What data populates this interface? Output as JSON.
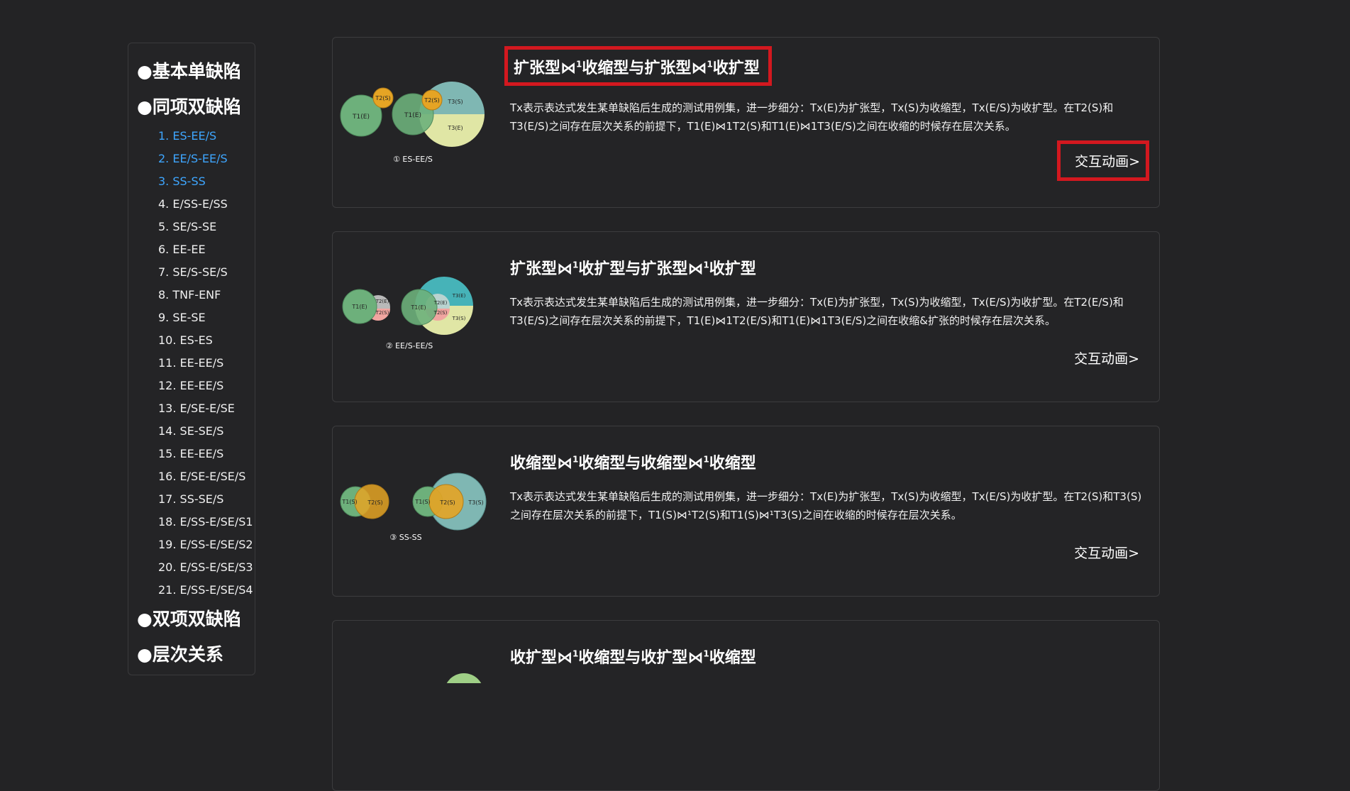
{
  "sidebar": {
    "sections": [
      {
        "label": "●基本单缺陷"
      },
      {
        "label": "●同项双缺陷"
      },
      {
        "label": "●双项双缺陷"
      },
      {
        "label": "●层次关系"
      }
    ],
    "items": [
      {
        "label": "1. ES-EE/S"
      },
      {
        "label": "2. EE/S-EE/S"
      },
      {
        "label": "3. SS-SS"
      },
      {
        "label": "4. E/SS-E/SS"
      },
      {
        "label": "5. SE/S-SE"
      },
      {
        "label": "6. EE-EE"
      },
      {
        "label": "7. SE/S-SE/S"
      },
      {
        "label": "8. TNF-ENF"
      },
      {
        "label": "9. SE-SE"
      },
      {
        "label": "10. ES-ES"
      },
      {
        "label": "11. EE-EE/S"
      },
      {
        "label": "12. EE-EE/S"
      },
      {
        "label": "13. E/SE-E/SE"
      },
      {
        "label": "14. SE-SE/S"
      },
      {
        "label": "15. EE-EE/S"
      },
      {
        "label": "16. E/SE-E/SE/S"
      },
      {
        "label": "17. SS-SE/S"
      },
      {
        "label": "18. E/SS-E/SE/S1"
      },
      {
        "label": "19. E/SS-E/SE/S2"
      },
      {
        "label": "20. E/SS-E/SE/S3"
      },
      {
        "label": "21. E/SS-E/SE/S4"
      }
    ],
    "active_color": "#3ea6ff"
  },
  "cards": [
    {
      "title_a": "扩张型⋈",
      "title_sup1": "1",
      "title_b": "收缩型与扩张型⋈",
      "title_sup2": "1",
      "title_c": "收扩型",
      "desc": "Tx表示表达式发生某单缺陷后生成的测试用例集，进一步细分：Tx(E)为扩张型，Tx(S)为收缩型，Tx(E/S)为收扩型。在T2(S)和T3(E/S)之间存在层次关系的前提下，T1(E)⋈1T2(S)和T1(E)⋈1T3(E/S)之间在收缩的时候存在层次关系。",
      "button": "交互动画>",
      "figure": {
        "c1": "T1(E)",
        "c2": "T2(S)",
        "c3": "T1(E)",
        "c4": "T2(S)",
        "c5": "T3(S)",
        "c6": "T3(E)",
        "caption": "① ES-EE/S"
      }
    },
    {
      "title_a": "扩张型⋈",
      "title_sup1": "1",
      "title_b": "收扩型与扩张型⋈",
      "title_sup2": "1",
      "title_c": "收扩型",
      "desc": "Tx表示表达式发生某单缺陷后生成的测试用例集，进一步细分：Tx(E)为扩张型，Tx(S)为收缩型，Tx(E/S)为收扩型。在T2(E/S)和T3(E/S)之间存在层次关系的前提下，T1(E)⋈1T2(E/S)和T1(E)⋈1T3(E/S)之间在收缩&扩张的时候存在层次关系。",
      "button": "交互动画>",
      "figure": {
        "c1": "T1(E)",
        "c2": "T2(E)",
        "c2b": "T2(S)",
        "c3": "T1(E)",
        "c4": "T2(E)",
        "c4b": "T2(S)",
        "c5": "T3(E)",
        "c6": "T3(S)",
        "caption": "② EE/S-EE/S"
      }
    },
    {
      "title_a": "收缩型⋈",
      "title_sup1": "1",
      "title_b": "收缩型与收缩型⋈",
      "title_sup2": "1",
      "title_c": "收缩型",
      "desc": "Tx表示表达式发生某单缺陷后生成的测试用例集，进一步细分：Tx(E)为扩张型，Tx(S)为收缩型，Tx(E/S)为收扩型。在T2(S)和T3(S)之间存在层次关系的前提下，T1(S)⋈¹T2(S)和T1(S)⋈¹T3(S)之间在收缩的时候存在层次关系。",
      "button": "交互动画>",
      "figure": {
        "c1": "T1(S)",
        "c2": "T2(S)",
        "c3": "T1(S)",
        "c4": "T2(S)",
        "c5": "T3(S)",
        "caption": "③ SS-SS"
      }
    },
    {
      "title_a": "收扩型⋈",
      "title_sup1": "1",
      "title_b": "收缩型与收扩型⋈",
      "title_sup2": "1",
      "title_c": "收缩型"
    }
  ],
  "colors": {
    "highlight_border": "#d3181f",
    "green": "#6db07b",
    "orange": "#e5a424",
    "teal": "#7fb7b3",
    "yellow": "#e0e6a5",
    "cyan": "#46b3b8",
    "pink": "#f1a5a0",
    "gray": "#b9b9b9"
  }
}
